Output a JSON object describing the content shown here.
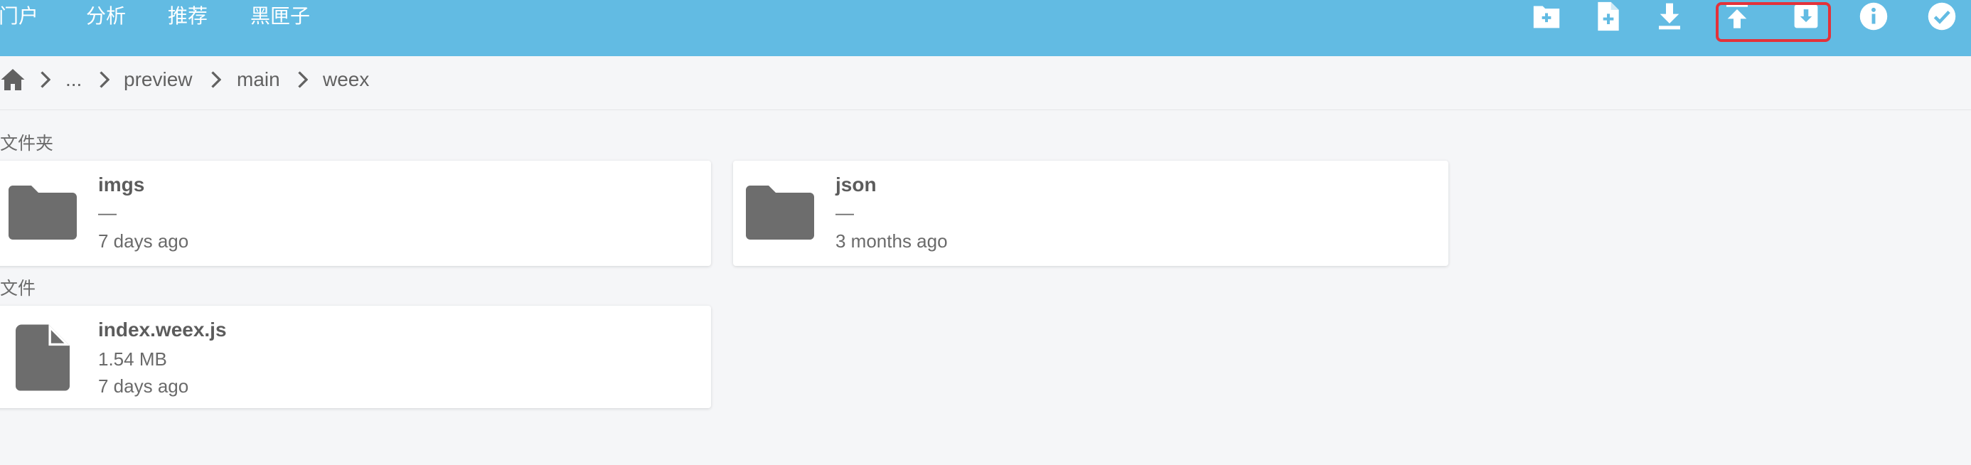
{
  "topnav": {
    "items": [
      {
        "label": "门户"
      },
      {
        "label": "分析"
      },
      {
        "label": "推荐"
      },
      {
        "label": "黑匣子"
      }
    ]
  },
  "actions": [
    {
      "icon": "new-folder-icon"
    },
    {
      "icon": "new-file-icon"
    },
    {
      "icon": "download-icon"
    },
    {
      "icon": "upload-icon"
    },
    {
      "icon": "download-archive-icon"
    },
    {
      "icon": "info-icon"
    },
    {
      "icon": "check-circle-icon"
    }
  ],
  "colors": {
    "topbar": "#62bbe3",
    "highlight": "#e3323a",
    "icon_gray": "#6d6d6d",
    "background": "#f5f6f8"
  },
  "breadcrumb": {
    "home_icon": "home-icon",
    "items": [
      "...",
      "preview",
      "main",
      "weex"
    ]
  },
  "sections": {
    "folders_title": "文件夹",
    "files_title": "文件"
  },
  "folders": [
    {
      "name": "imgs",
      "size": "—",
      "modified": "7 days ago",
      "icon": "folder-icon"
    },
    {
      "name": "json",
      "size": "—",
      "modified": "3 months ago",
      "icon": "folder-icon"
    }
  ],
  "files": [
    {
      "name": "index.weex.js",
      "size": "1.54 MB",
      "modified": "7 days ago",
      "icon": "file-icon"
    }
  ]
}
